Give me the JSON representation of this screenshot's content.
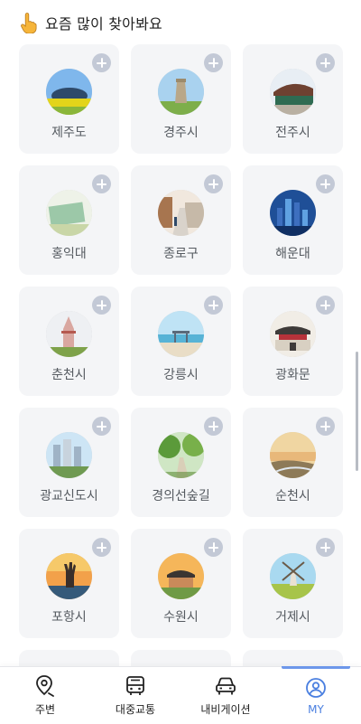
{
  "header": {
    "title": "요즘 많이 찾아봐요",
    "icon": "pointing-up-hand-icon"
  },
  "places": [
    {
      "name": "제주도",
      "thumb": "jeju-island-image"
    },
    {
      "name": "경주시",
      "thumb": "gyeongju-cheomseongdae-image"
    },
    {
      "name": "전주시",
      "thumb": "jeonju-hanok-roof-image"
    },
    {
      "name": "홍익대",
      "thumb": "hongik-sign-image"
    },
    {
      "name": "종로구",
      "thumb": "jongno-street-image"
    },
    {
      "name": "해운대",
      "thumb": "haeundae-skyline-image"
    },
    {
      "name": "춘천시",
      "thumb": "chuncheon-tower-image"
    },
    {
      "name": "강릉시",
      "thumb": "gangneung-beach-image"
    },
    {
      "name": "광화문",
      "thumb": "gwanghwamun-gate-image"
    },
    {
      "name": "광교신도시",
      "thumb": "gwanggyo-apartments-image"
    },
    {
      "name": "경의선숲길",
      "thumb": "forest-path-image"
    },
    {
      "name": "순천시",
      "thumb": "suncheon-wetland-image"
    },
    {
      "name": "포항시",
      "thumb": "pohang-hand-statue-image"
    },
    {
      "name": "수원시",
      "thumb": "suwon-fortress-image"
    },
    {
      "name": "거제시",
      "thumb": "geoje-windmill-image"
    }
  ],
  "tabs": [
    {
      "label": "주변",
      "icon": "location-pin-icon",
      "active": false
    },
    {
      "label": "대중교통",
      "icon": "bus-icon",
      "active": false
    },
    {
      "label": "내비게이션",
      "icon": "car-icon",
      "active": false
    },
    {
      "label": "MY",
      "icon": "user-profile-icon",
      "active": true
    }
  ],
  "colors": {
    "accent": "#4a7fe0",
    "card_bg": "#f4f5f7",
    "plus_bg": "#c3c9d6"
  }
}
